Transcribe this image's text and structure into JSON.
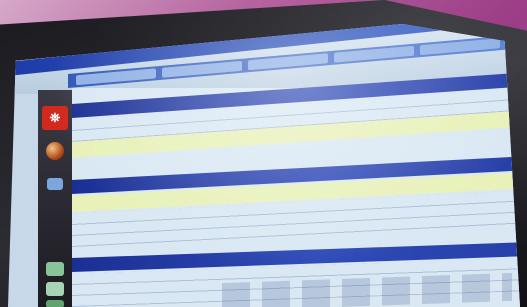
{
  "app": {
    "logo_label": "⛯"
  },
  "tabs": [],
  "sections": [],
  "colors": {
    "frame": "#1c1c22",
    "title_bar": "#1e3ca8",
    "section_bar": "#1b2f93",
    "row_highlight": "#e7f1b8",
    "panel_bg": "#d9e8f3",
    "logo_red": "#d1291e",
    "background": "#b6649f"
  },
  "icons": {
    "logo": "app-logo-icon",
    "orb": "orb-icon",
    "card": "card-icon",
    "tool1": "toolbar-icon-1",
    "tool2": "toolbar-icon-2",
    "tool3": "toolbar-icon-3"
  }
}
